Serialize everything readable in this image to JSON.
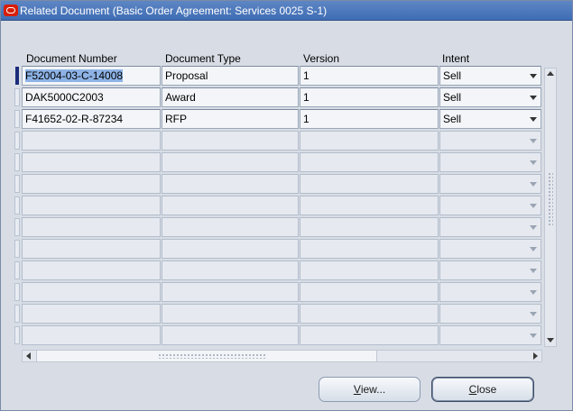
{
  "window": {
    "title": "Related Document (Basic Order Agreement: Services 0025 S-1)"
  },
  "table": {
    "headers": {
      "document_number": "Document Number",
      "document_type": "Document Type",
      "version": "Version",
      "intent": "Intent"
    },
    "rows": [
      {
        "document_number": "F52004-03-C-14008",
        "document_type": "Proposal",
        "version": "1",
        "intent": "Sell"
      },
      {
        "document_number": "DAK5000C2003",
        "document_type": "Award",
        "version": "1",
        "intent": "Sell"
      },
      {
        "document_number": "F41652-02-R-87234",
        "document_type": "RFP",
        "version": "1",
        "intent": "Sell"
      },
      {
        "document_number": "",
        "document_type": "",
        "version": "",
        "intent": ""
      },
      {
        "document_number": "",
        "document_type": "",
        "version": "",
        "intent": ""
      },
      {
        "document_number": "",
        "document_type": "",
        "version": "",
        "intent": ""
      },
      {
        "document_number": "",
        "document_type": "",
        "version": "",
        "intent": ""
      },
      {
        "document_number": "",
        "document_type": "",
        "version": "",
        "intent": ""
      },
      {
        "document_number": "",
        "document_type": "",
        "version": "",
        "intent": ""
      },
      {
        "document_number": "",
        "document_type": "",
        "version": "",
        "intent": ""
      },
      {
        "document_number": "",
        "document_type": "",
        "version": "",
        "intent": ""
      },
      {
        "document_number": "",
        "document_type": "",
        "version": "",
        "intent": ""
      },
      {
        "document_number": "",
        "document_type": "",
        "version": "",
        "intent": ""
      }
    ]
  },
  "buttons": {
    "view_mnemonic": "V",
    "view_rest": "iew...",
    "close_mnemonic": "C",
    "close_rest": "lose"
  },
  "colors": {
    "titlebar": "#4a78bc",
    "background": "#d8dde5",
    "active_row_indicator": "#1c2c7a",
    "selection": "#8db3e6"
  }
}
